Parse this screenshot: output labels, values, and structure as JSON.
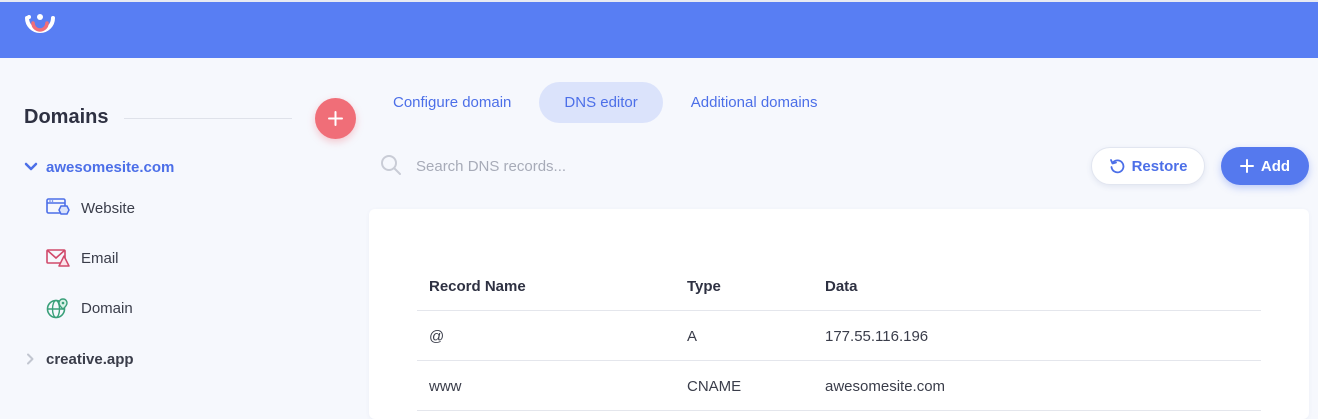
{
  "header": {
    "logo_icon": "brand-logo"
  },
  "sidebar": {
    "title": "Domains",
    "add_button_icon": "plus-icon",
    "domains": [
      {
        "label": "awesomesite.com",
        "expanded": true,
        "items": [
          {
            "label": "Website",
            "icon": "website-icon"
          },
          {
            "label": "Email",
            "icon": "email-icon"
          },
          {
            "label": "Domain",
            "icon": "globe-icon"
          }
        ]
      },
      {
        "label": "creative.app",
        "expanded": false
      }
    ]
  },
  "tabs": [
    {
      "label": "Configure domain",
      "active": false
    },
    {
      "label": "DNS editor",
      "active": true
    },
    {
      "label": "Additional domains",
      "active": false
    }
  ],
  "toolbar": {
    "search_placeholder": "Search DNS records...",
    "restore_label": "Restore",
    "add_label": "Add"
  },
  "table": {
    "columns": [
      "Record Name",
      "Type",
      "Data"
    ],
    "rows": [
      [
        "@",
        "A",
        "177.55.116.196"
      ],
      [
        "www",
        "CNAME",
        "awesomesite.com"
      ]
    ]
  },
  "colors": {
    "topbar": "#587ef3",
    "accent": "#4c6fe8",
    "add_domain": "#f06e78",
    "tab_active_bg": "#dbe3fb"
  }
}
